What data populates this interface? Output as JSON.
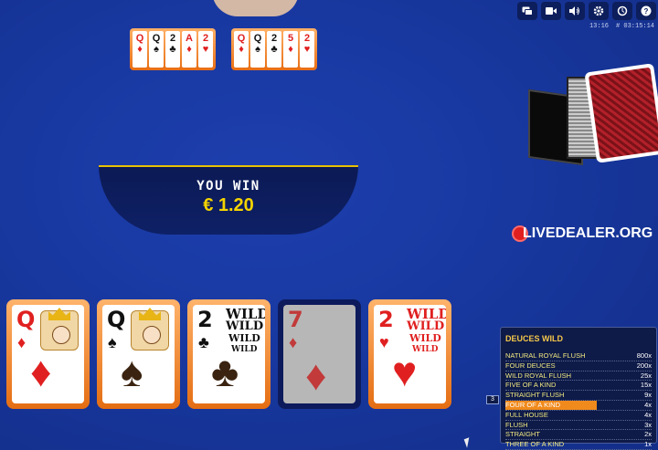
{
  "toolbar": {
    "buttons": [
      "chat",
      "video",
      "sound",
      "settings",
      "history",
      "help"
    ],
    "time": "13:16",
    "round": "# 03:15:14"
  },
  "mini_hands": [
    [
      {
        "rank": "Q",
        "suit": "♦",
        "color": "red"
      },
      {
        "rank": "Q",
        "suit": "♠",
        "color": "black"
      },
      {
        "rank": "2",
        "suit": "♣",
        "color": "black"
      },
      {
        "rank": "A",
        "suit": "♦",
        "color": "red"
      },
      {
        "rank": "2",
        "suit": "♥",
        "color": "red"
      }
    ],
    [
      {
        "rank": "Q",
        "suit": "♦",
        "color": "red"
      },
      {
        "rank": "Q",
        "suit": "♠",
        "color": "black"
      },
      {
        "rank": "2",
        "suit": "♣",
        "color": "black"
      },
      {
        "rank": "5",
        "suit": "♦",
        "color": "red"
      },
      {
        "rank": "2",
        "suit": "♥",
        "color": "red"
      }
    ]
  ],
  "win": {
    "title": "YOU WIN",
    "amount": "€ 1.20"
  },
  "watermark": "LIVEDEALER.ORG",
  "hand": [
    {
      "rank": "Q",
      "suit": "♦",
      "color": "red",
      "type": "face",
      "held": true
    },
    {
      "rank": "Q",
      "suit": "♠",
      "color": "black",
      "type": "face",
      "held": true
    },
    {
      "rank": "2",
      "suit": "♣",
      "color": "black",
      "type": "wild",
      "held": true
    },
    {
      "rank": "7",
      "suit": "♦",
      "color": "red",
      "type": "plain",
      "held": false
    },
    {
      "rank": "2",
      "suit": "♥",
      "color": "red",
      "type": "wild",
      "held": true
    }
  ],
  "wild_word": "WILD",
  "paytable": {
    "title": "DEUCES WILD",
    "marker": "3",
    "rows": [
      {
        "name": "NATURAL ROYAL FLUSH",
        "pay": "800x"
      },
      {
        "name": "FOUR DEUCES",
        "pay": "200x"
      },
      {
        "name": "WILD ROYAL FLUSH",
        "pay": "25x"
      },
      {
        "name": "FIVE OF A KIND",
        "pay": "15x"
      },
      {
        "name": "STRAIGHT FLUSH",
        "pay": "9x"
      },
      {
        "name": "FOUR OF A KIND",
        "pay": "4x",
        "highlight": true
      },
      {
        "name": "FULL HOUSE",
        "pay": "4x"
      },
      {
        "name": "FLUSH",
        "pay": "3x"
      },
      {
        "name": "STRAIGHT",
        "pay": "2x"
      },
      {
        "name": "THREE OF A KIND",
        "pay": "1x"
      }
    ]
  }
}
